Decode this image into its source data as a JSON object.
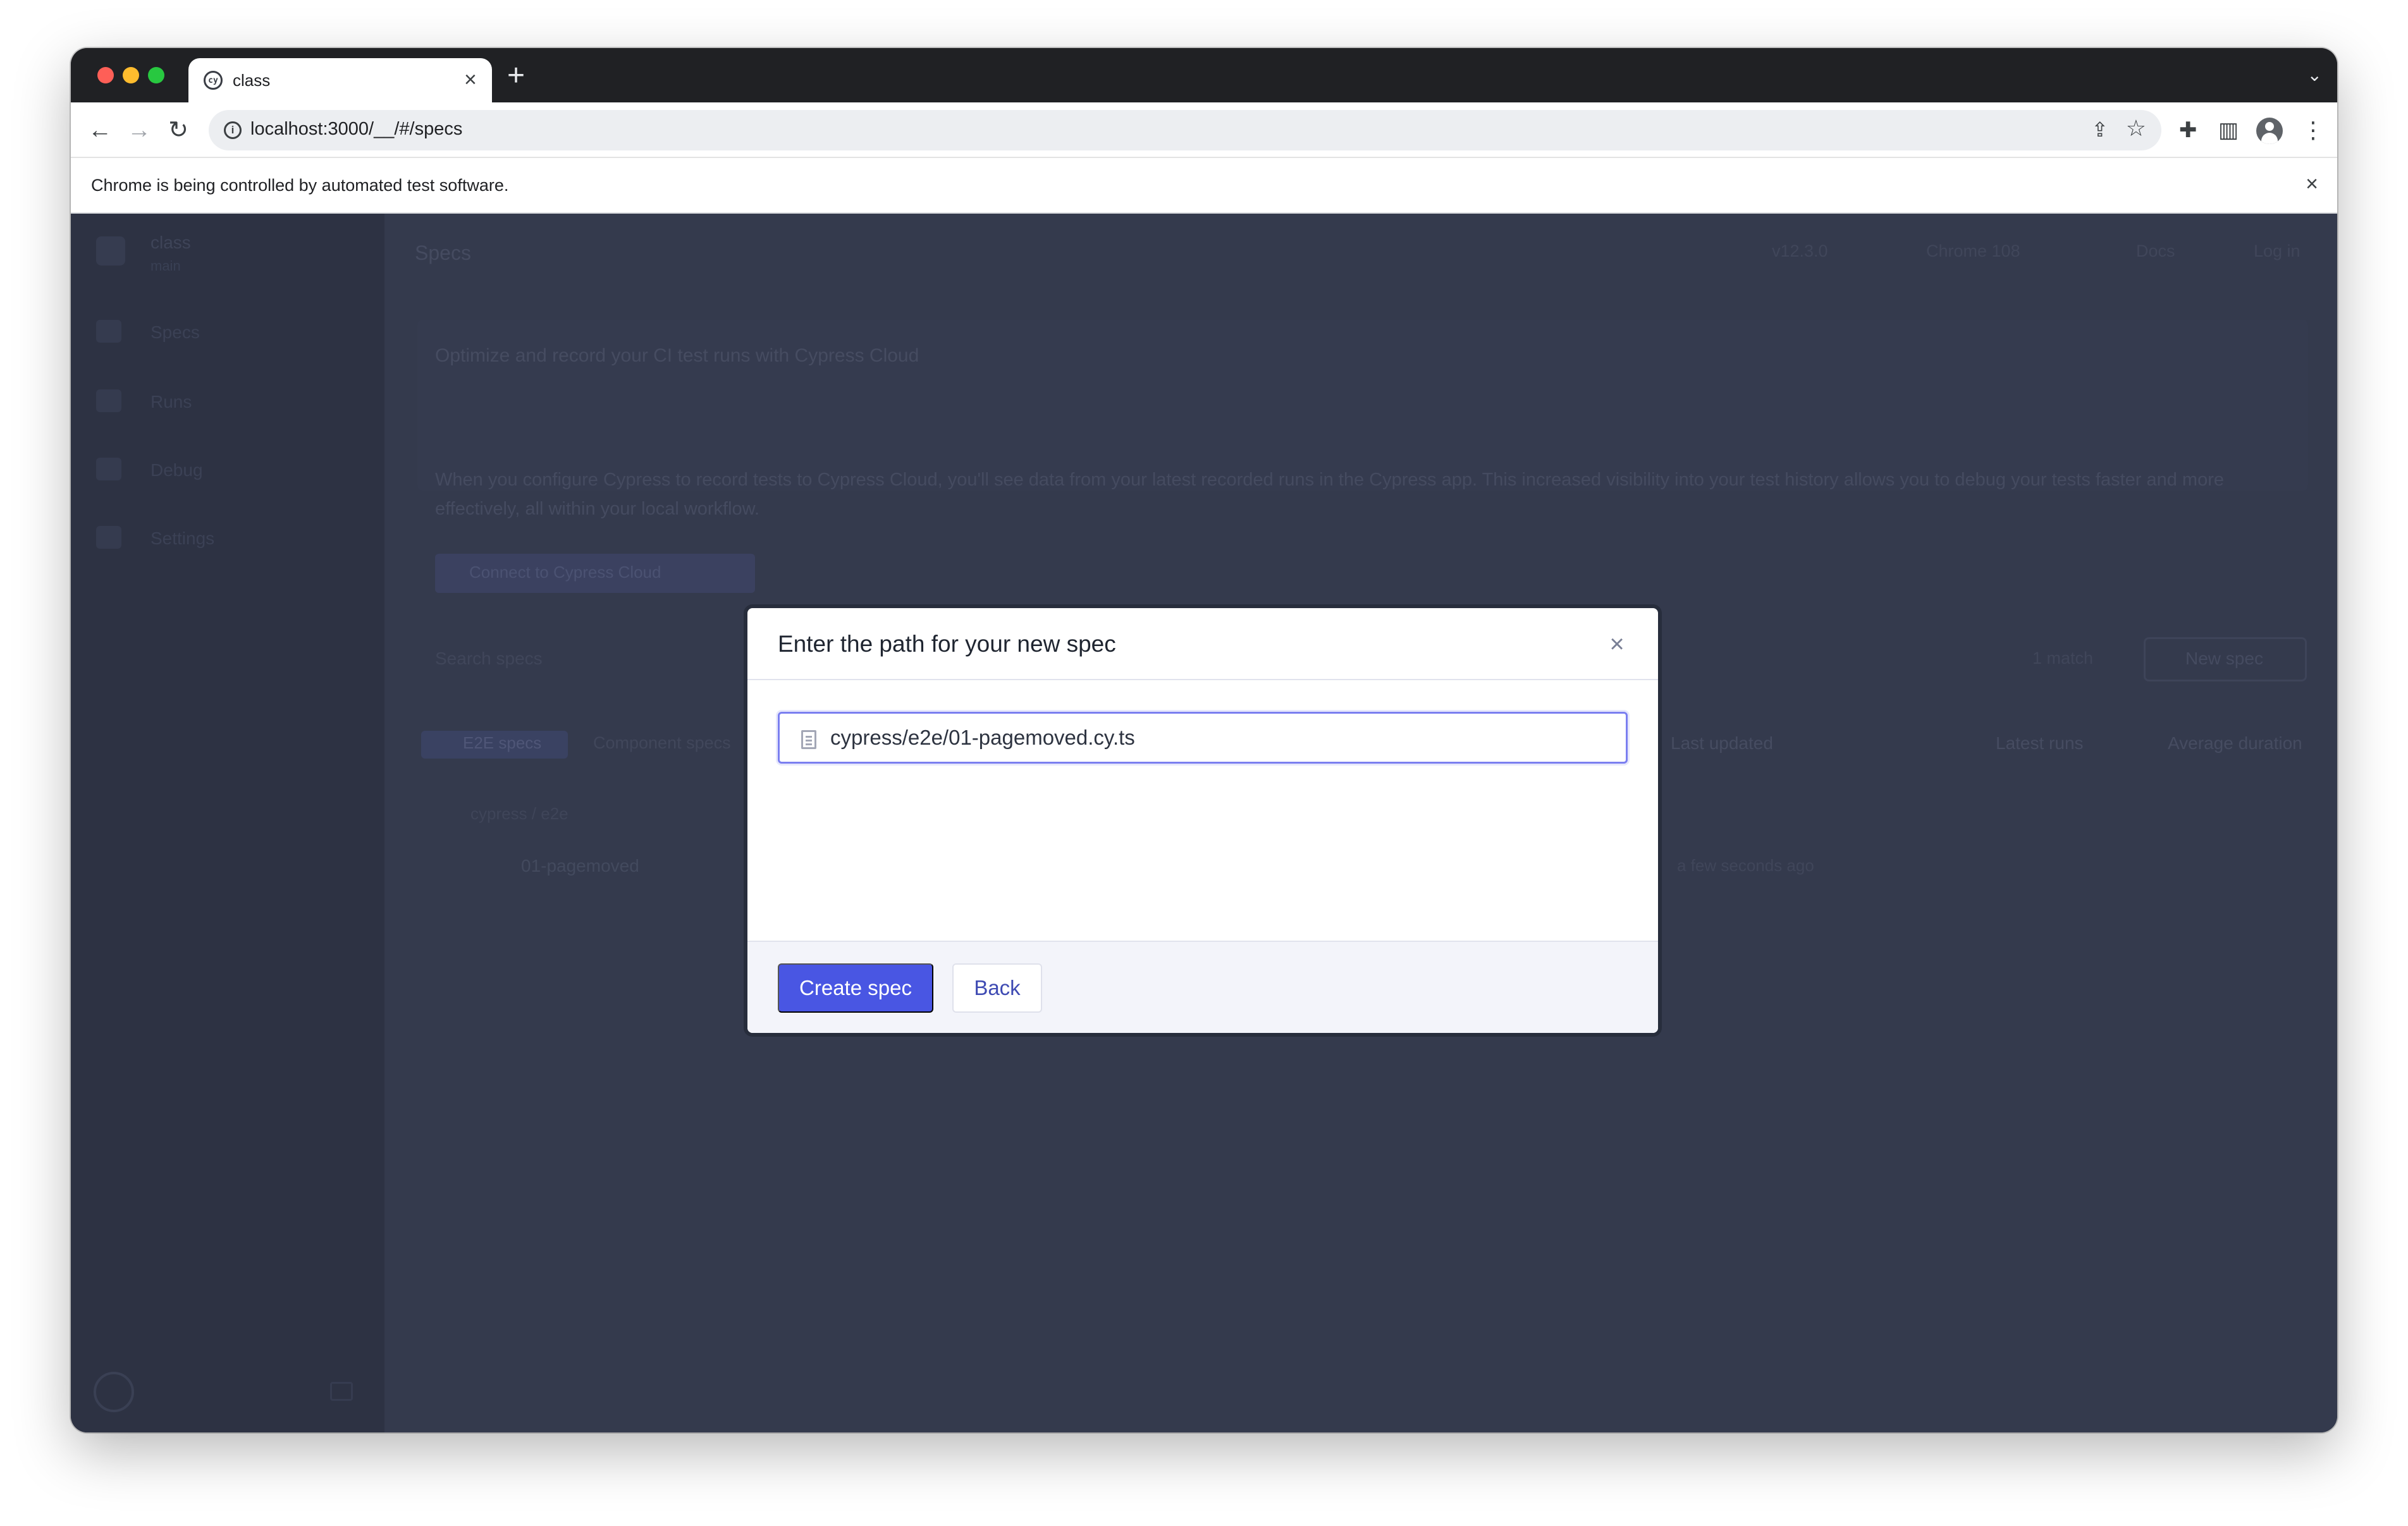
{
  "browser": {
    "tab_title": "class",
    "url": "localhost:3000/__/#/specs",
    "automation_notice": "Chrome is being controlled by automated test software."
  },
  "app": {
    "page_title": "Specs",
    "header_links": [
      "v12.3.0",
      "Chrome 108",
      "Docs",
      "Log in"
    ],
    "sidebar": {
      "project_name": "class",
      "project_branch": "main",
      "items": [
        {
          "label": "Specs"
        },
        {
          "label": "Runs"
        },
        {
          "label": "Debug"
        },
        {
          "label": "Settings"
        }
      ]
    },
    "banner": {
      "title": "Optimize and record your CI test runs with Cypress Cloud",
      "body": "When you configure Cypress to record tests to Cypress Cloud, you'll see data from your latest recorded runs in the Cypress app. This increased visibility into your test history allows you to debug your tests faster and more effectively, all within your local workflow.",
      "button": "Connect to Cypress Cloud"
    },
    "search_placeholder": "Search specs",
    "count_label": "1 match",
    "new_spec_label": "New spec",
    "tabs": [
      "E2E specs",
      "Component specs"
    ],
    "columns": [
      "Last updated",
      "Latest runs",
      "Average duration"
    ],
    "tree": {
      "folder": "cypress / e2e",
      "file": "01-pagemoved",
      "meta": "a few seconds ago"
    }
  },
  "modal": {
    "title": "Enter the path for your new spec",
    "path_value": "cypress/e2e/01-pagemoved.cy.ts",
    "create_label": "Create spec",
    "back_label": "Back"
  },
  "icons": {
    "close": "close-icon",
    "file": "document-icon",
    "favicon": "cypress-favicon"
  },
  "colors": {
    "primary_button": "#4956e3",
    "overlay": "#343a4d",
    "focus_ring": "#7b7ff0"
  }
}
